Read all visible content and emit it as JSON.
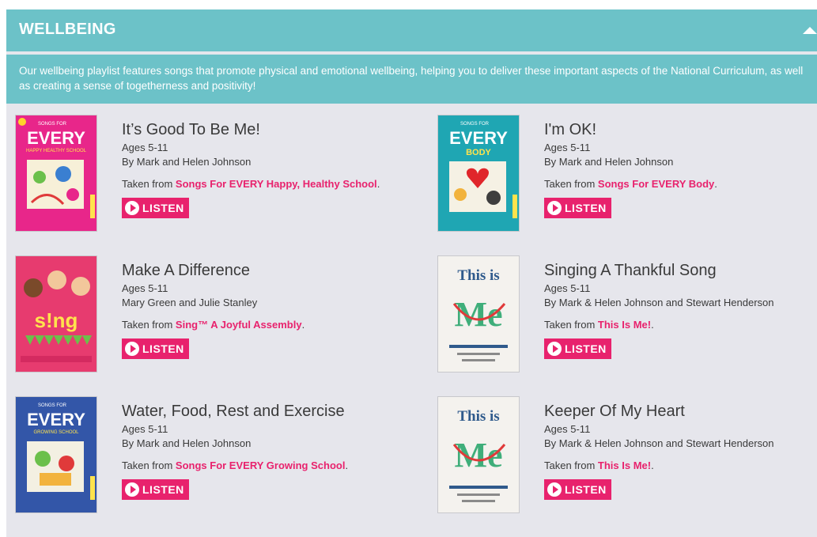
{
  "section": {
    "title": "WELLBEING",
    "intro": "Our wellbeing playlist features songs that promote physical and emotional wellbeing, helping you to deliver these important aspects of the National Curriculum, as well as creating a sense of togetherness and positivity!"
  },
  "listen_label": "LISTEN",
  "taken_prefix": "Taken from ",
  "songs": [
    {
      "title": "It’s Good To Be Me!",
      "ages": "Ages 5-11",
      "by": "By Mark and Helen Johnson",
      "source": "Songs For EVERY Happy, Healthy School",
      "cover_text": "EVERY",
      "cover_sub": "HAPPY HEALTHY SCHOOL",
      "cover_color": "#e8268a"
    },
    {
      "title": "I'm OK!",
      "ages": "Ages 5-11",
      "by": "By Mark and Helen Johnson",
      "source": "Songs For EVERY Body",
      "cover_text": "EVERY",
      "cover_sub": "BODY",
      "cover_color": "#1fa6b3"
    },
    {
      "title": "Make A Difference",
      "ages": "Ages 5-11",
      "by": "Mary Green and Julie Stanley",
      "source": "Sing™ A Joyful Assembly",
      "cover_text": "s!ng",
      "cover_sub": "",
      "cover_color": "#e73b6f"
    },
    {
      "title": "Singing A Thankful Song",
      "ages": "Ages 5-11",
      "by": "By Mark & Helen Johnson and Stewart Henderson",
      "source": "This Is Me!",
      "cover_text": "This is",
      "cover_sub": "Me",
      "cover_color": "#f4f2ee"
    },
    {
      "title": "Water, Food, Rest and Exercise",
      "ages": "Ages 5-11",
      "by": "By Mark and Helen Johnson",
      "source": "Songs For EVERY Growing School",
      "cover_text": "EVERY",
      "cover_sub": "GROWING SCHOOL",
      "cover_color": "#3356a8"
    },
    {
      "title": "Keeper Of My Heart",
      "ages": "Ages 5-11",
      "by": "By Mark & Helen Johnson and Stewart Henderson",
      "source": "This Is Me!",
      "cover_text": "This is",
      "cover_sub": "Me",
      "cover_color": "#f4f2ee"
    }
  ]
}
